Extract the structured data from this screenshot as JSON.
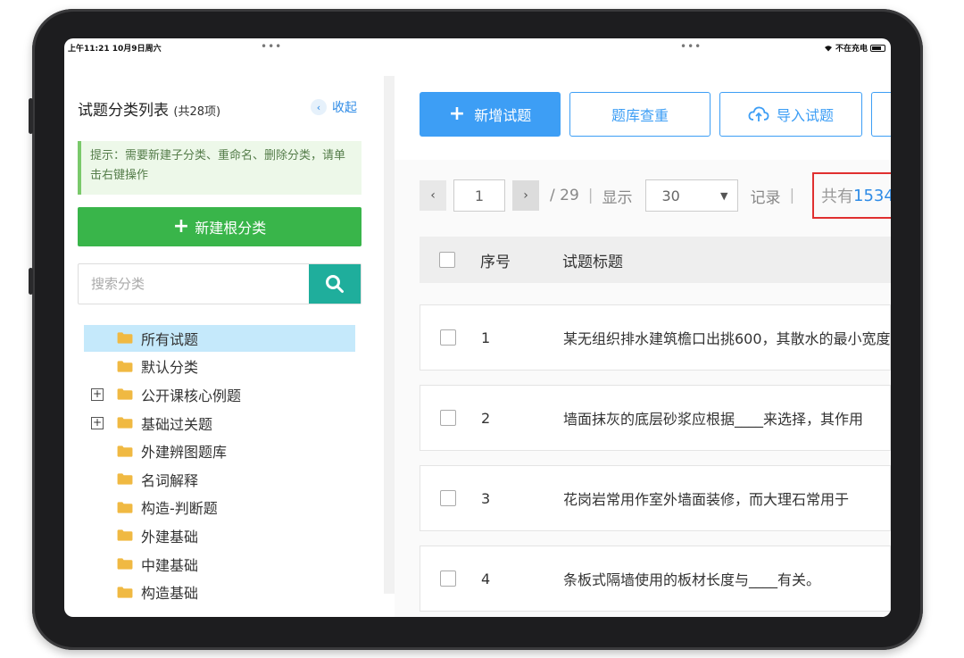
{
  "status_bar": {
    "time_date": "上午11:21  10月9日周六",
    "charging": "不在充电",
    "dots": "•••"
  },
  "sidebar": {
    "title": "试题分类列表",
    "count": "(共28项)",
    "collapse_label": "收起",
    "tip": "提示：需要新建子分类、重命名、删除分类，请单击右键操作",
    "new_root_label": "新建根分类",
    "search_placeholder": "搜索分类",
    "items": [
      {
        "label": "所有试题",
        "selected": true,
        "expandable": false
      },
      {
        "label": "默认分类",
        "selected": false,
        "expandable": false
      },
      {
        "label": "公开课核心例题",
        "selected": false,
        "expandable": true
      },
      {
        "label": "基础过关题",
        "selected": false,
        "expandable": true
      },
      {
        "label": "外建辨图题库",
        "selected": false,
        "expandable": false
      },
      {
        "label": "名词解释",
        "selected": false,
        "expandable": false
      },
      {
        "label": "构造-判断题",
        "selected": false,
        "expandable": false
      },
      {
        "label": "外建基础",
        "selected": false,
        "expandable": false
      },
      {
        "label": "中建基础",
        "selected": false,
        "expandable": false
      },
      {
        "label": "构造基础",
        "selected": false,
        "expandable": false
      }
    ]
  },
  "toolbar": {
    "add_label": "新增试题",
    "dedupe_label": "题库查重",
    "import_label": "导入试题"
  },
  "pager": {
    "current_page": "1",
    "total_pages": "/ 29",
    "show_label": "显示",
    "per_page": "30",
    "records_label": "记录",
    "total_label": "共有",
    "total_value": "1534"
  },
  "table": {
    "headers": {
      "num": "序号",
      "title": "试题标题"
    },
    "rows": [
      {
        "num": "1",
        "title": "某无组织排水建筑檐口出挑600，其散水的最小宽度"
      },
      {
        "num": "2",
        "title": "墙面抹灰的底层砂浆应根据____来选择，其作用"
      },
      {
        "num": "3",
        "title": "花岗岩常用作室外墙面装修，而大理石常用于"
      },
      {
        "num": "4",
        "title": "条板式隔墙使用的板材长度与____有关。"
      }
    ]
  },
  "colors": {
    "primary": "#3d9ef5",
    "success": "#39b54a",
    "search_btn": "#1fae9c",
    "highlight_border": "#e03030",
    "link": "#2e8be6"
  }
}
